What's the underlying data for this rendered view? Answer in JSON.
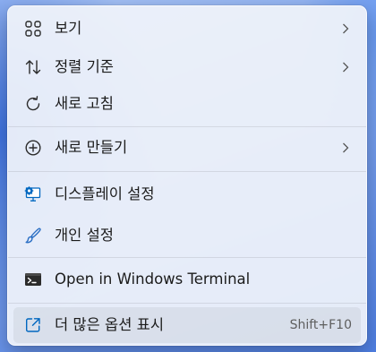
{
  "context_menu": {
    "items": [
      {
        "label": "보기",
        "icon": "grid-view-icon",
        "submenu": true
      },
      {
        "label": "정렬 기준",
        "icon": "sort-arrows-icon",
        "submenu": true
      },
      {
        "label": "새로 고침",
        "icon": "refresh-icon",
        "submenu": false
      },
      {
        "label": "새로 만들기",
        "icon": "add-circle-icon",
        "submenu": true
      },
      {
        "label": "디스플레이 설정",
        "icon": "display-settings-icon",
        "submenu": false
      },
      {
        "label": "개인 설정",
        "icon": "brush-icon",
        "submenu": false
      },
      {
        "label": "Open in Windows Terminal",
        "icon": "terminal-icon",
        "submenu": false
      },
      {
        "label": "더 많은 옵션 표시",
        "icon": "open-external-icon",
        "submenu": false,
        "shortcut": "Shift+F10"
      }
    ]
  },
  "colors": {
    "menu_background": "#f0f3fa",
    "text": "#1b1b1b",
    "shortcut_text": "#5e5e5e",
    "accent_blue": "#0067c0"
  }
}
